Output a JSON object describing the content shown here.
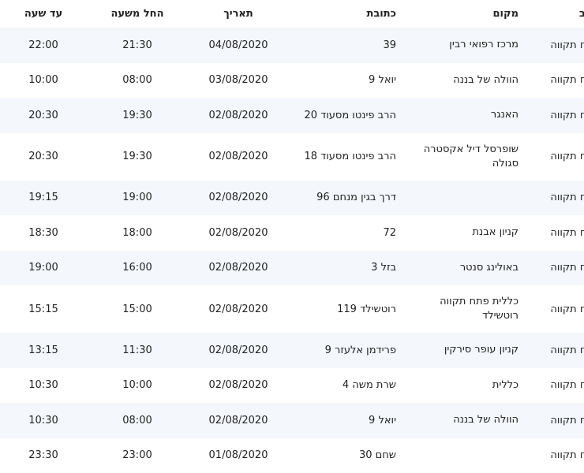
{
  "columns": {
    "city": "ישוב",
    "place": "מקום",
    "address": "כתובת",
    "date": "תאריך",
    "start": "החל משעה",
    "end": "עד שעה"
  },
  "rows": [
    {
      "city": "פתח תקווה",
      "place": "מרכז רפואי רבין",
      "address": "39",
      "date": "04/08/2020",
      "start": "21:30",
      "end": "22:00"
    },
    {
      "city": "פתח תקווה",
      "place": "הוולה של בננה",
      "address": "יואל 9",
      "date": "03/08/2020",
      "start": "08:00",
      "end": "10:00"
    },
    {
      "city": "פתח תקווה",
      "place": "האנגר",
      "address": "הרב פינטו מסעוד 20",
      "date": "02/08/2020",
      "start": "19:30",
      "end": "20:30"
    },
    {
      "city": "פתח תקווה",
      "place": "שופרסל דיל אקסטרה סגולה",
      "address": "הרב פינטו מסעוד 18",
      "date": "02/08/2020",
      "start": "19:30",
      "end": "20:30"
    },
    {
      "city": "פתח תקווה",
      "place": "",
      "address": "דרך בגין מנחם 96",
      "date": "02/08/2020",
      "start": "19:00",
      "end": "19:15"
    },
    {
      "city": "פתח תקווה",
      "place": "קניון אבנת",
      "address": "72",
      "date": "02/08/2020",
      "start": "18:00",
      "end": "18:30"
    },
    {
      "city": "פתח תקווה",
      "place": "באולינג סנטר",
      "address": "בזל 3",
      "date": "02/08/2020",
      "start": "16:00",
      "end": "19:00"
    },
    {
      "city": "פתח תקווה",
      "place": "כללית פתח תקווה רוטשילד",
      "address": "רוטשילד 119",
      "date": "02/08/2020",
      "start": "15:00",
      "end": "15:15"
    },
    {
      "city": "פתח תקווה",
      "place": "קניון עופר סירקין",
      "address": "פרידמן אלעזר 9",
      "date": "02/08/2020",
      "start": "11:30",
      "end": "13:15"
    },
    {
      "city": "פתח תקווה",
      "place": "כללית",
      "address": "שרת משה 4",
      "date": "02/08/2020",
      "start": "10:00",
      "end": "10:30"
    },
    {
      "city": "פתח תקווה",
      "place": "הוולה של בננה",
      "address": "יואל 9",
      "date": "02/08/2020",
      "start": "08:00",
      "end": "10:30"
    },
    {
      "city": "פתח תקווה",
      "place": "",
      "address": "שחם 30",
      "date": "01/08/2020",
      "start": "23:00",
      "end": "23:30"
    }
  ]
}
